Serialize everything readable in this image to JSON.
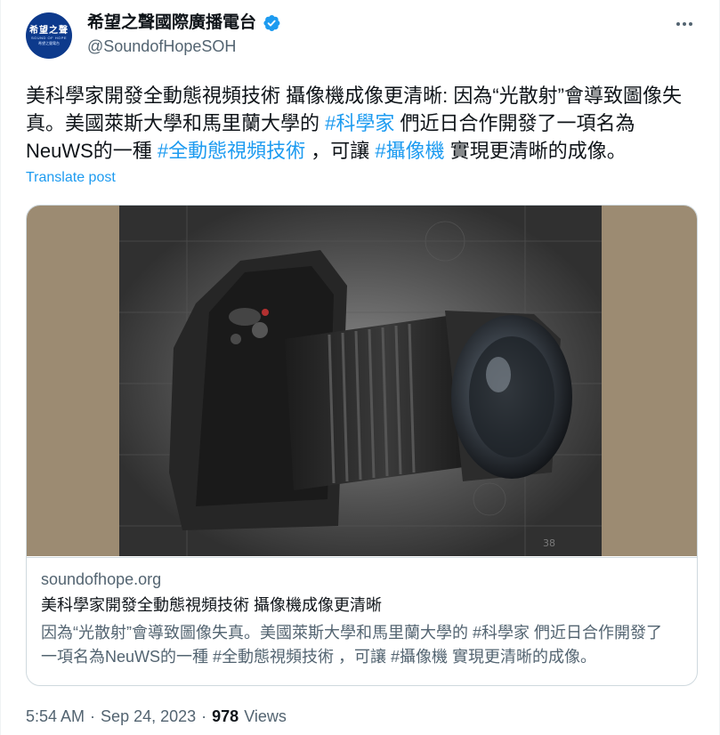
{
  "account": {
    "display_name": "希望之聲國際廣播電台",
    "handle": "@SoundofHopeSOH",
    "avatar_text": "希望之聲",
    "avatar_sub1": "SOUND OF HOPE",
    "avatar_sub2": "希望之聲電台"
  },
  "tweet": {
    "text_1": "美科學家開發全動態視頻技術 攝像機成像更清晰: 因為“光散射”會導致圖像失真。美國萊斯大學和馬里蘭大學的 ",
    "hashtag_1": "#科學家",
    "text_2": " 們近日合作開發了一項名為NeuWS的一種 ",
    "hashtag_2": "#全動態視頻技術",
    "text_3": " ，可讓 ",
    "hashtag_3": "#攝像機",
    "text_4": " 實現更清晰的成像。",
    "translate_label": "Translate post"
  },
  "card": {
    "domain": "soundofhope.org",
    "title": "美科學家開發全動態視頻技術 攝像機成像更清晰",
    "description": "因為“光散射”會導致圖像失真。美國萊斯大學和馬里蘭大學的 #科學家 們近日合作開發了一項名為NeuWS的一種 #全動態視頻技術 ，可讓 #攝像機 實現更清晰的成像。",
    "image_caption_mark": "38"
  },
  "meta": {
    "time": "5:54 AM",
    "separator_1": "·",
    "date": "Sep 24, 2023",
    "separator_2": "·",
    "views_count": "978",
    "views_label": "Views"
  },
  "colors": {
    "link": "#1d9bf0",
    "secondary_text": "#536471",
    "verified": "#1d9bf0",
    "card_image_bg": "#9c8b72"
  },
  "icons": {
    "verified": "verified-badge-icon",
    "more": "more-options-icon"
  }
}
